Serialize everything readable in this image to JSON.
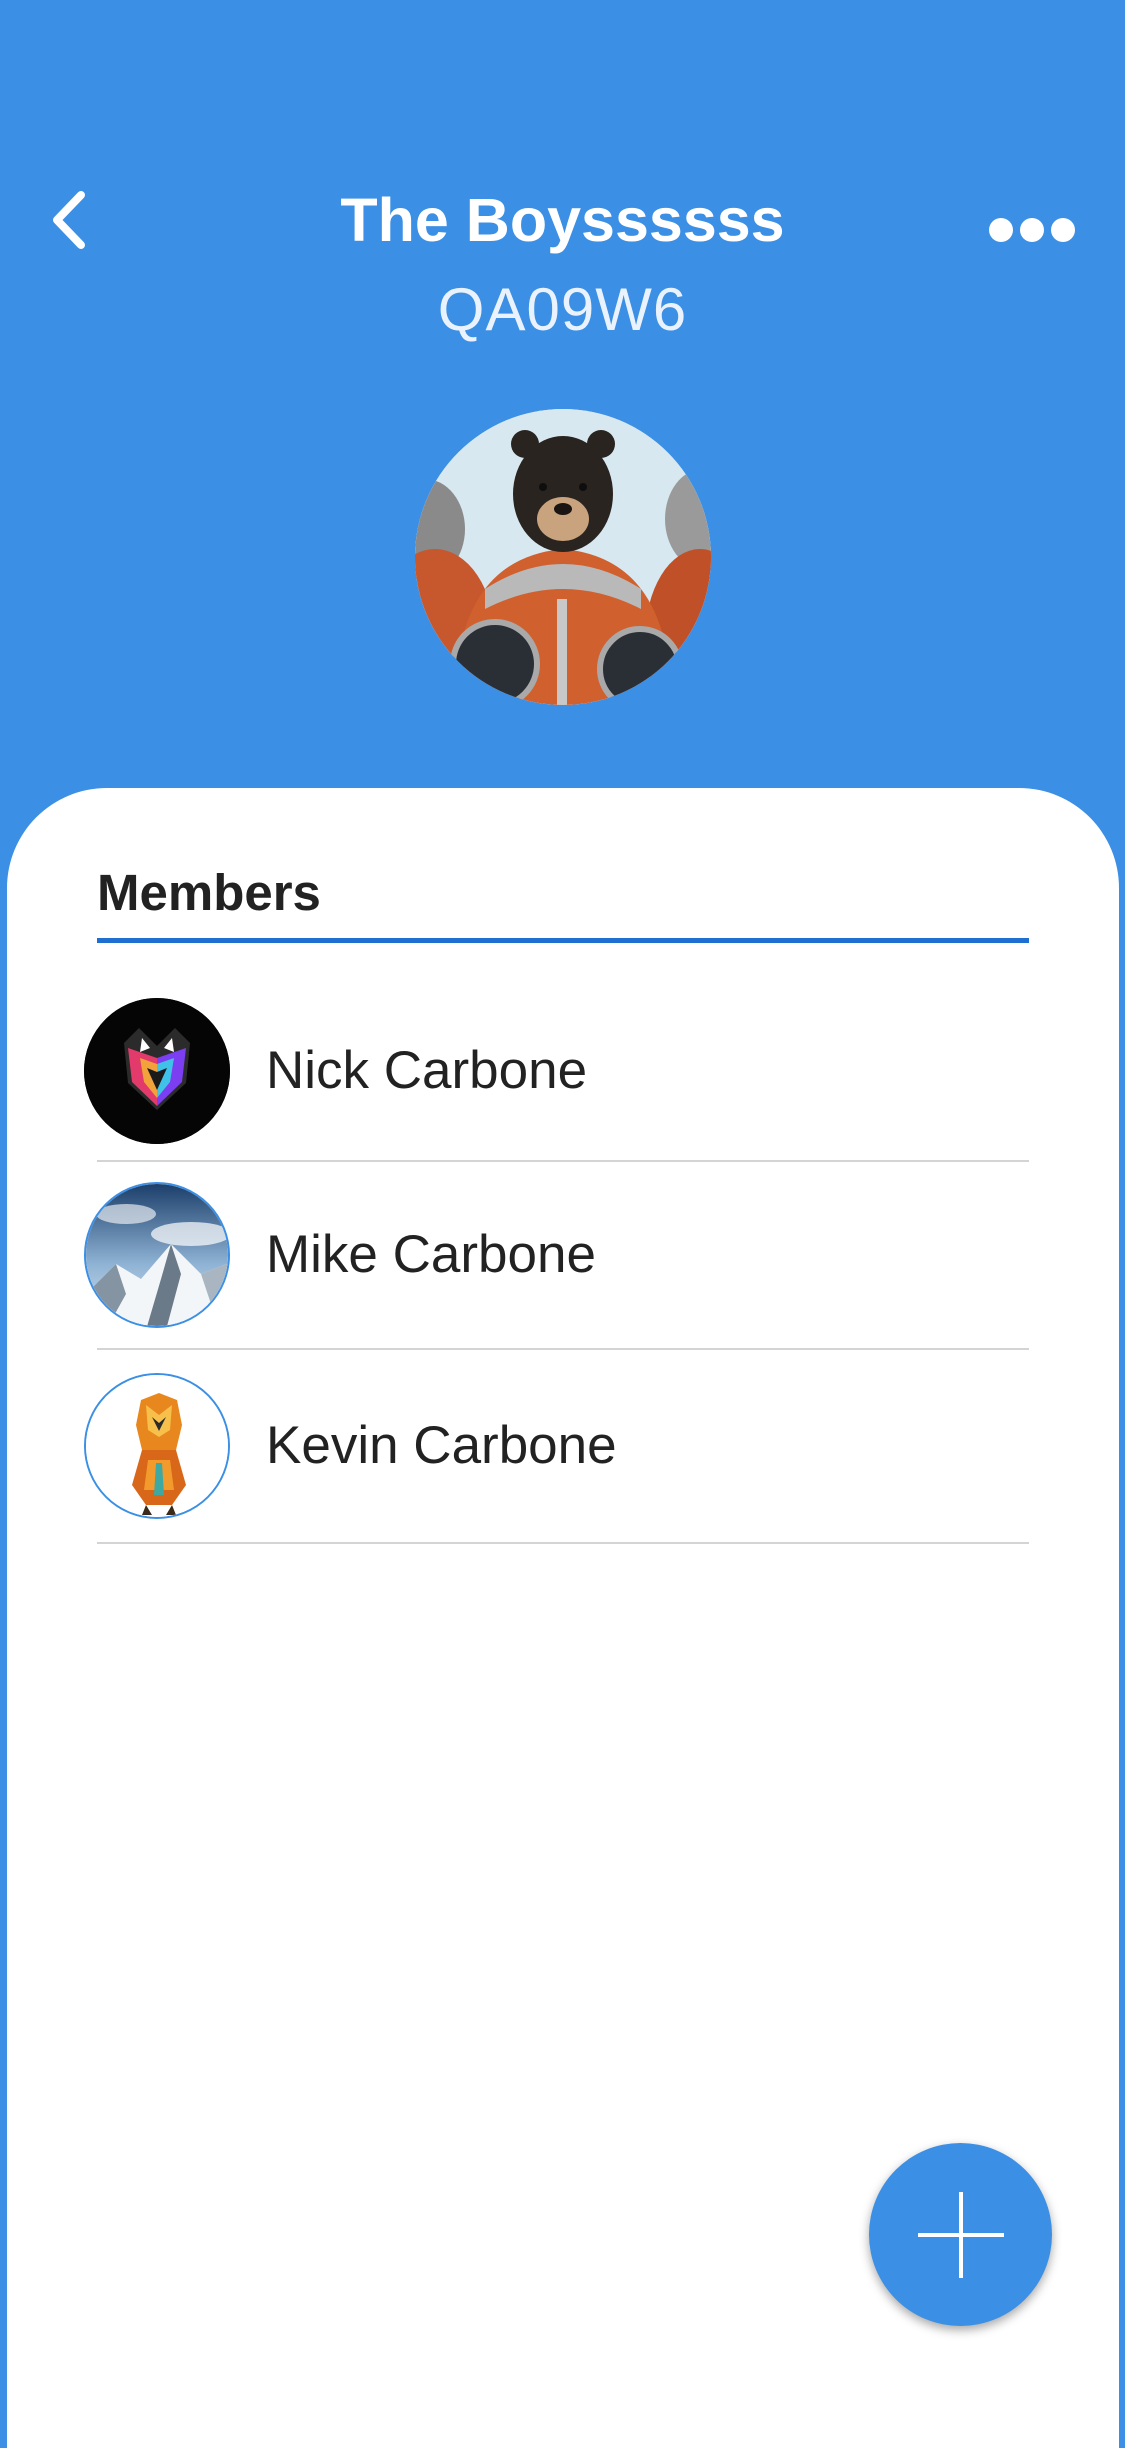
{
  "header": {
    "title": "The Boyssssss",
    "code": "QA09W6",
    "back_icon": "chevron-left-icon",
    "more_icon": "more-horizontal-icon",
    "background_color": "#3b8fe4"
  },
  "members_section": {
    "label": "Members",
    "accent_color": "#1f6fd1",
    "members": [
      {
        "name": "Nick Carbone",
        "avatar": "geometric-wolf-avatar"
      },
      {
        "name": "Mike Carbone",
        "avatar": "snowy-mountain-avatar"
      },
      {
        "name": "Kevin Carbone",
        "avatar": "geometric-tiger-avatar"
      }
    ]
  },
  "fab": {
    "icon": "plus-icon"
  }
}
